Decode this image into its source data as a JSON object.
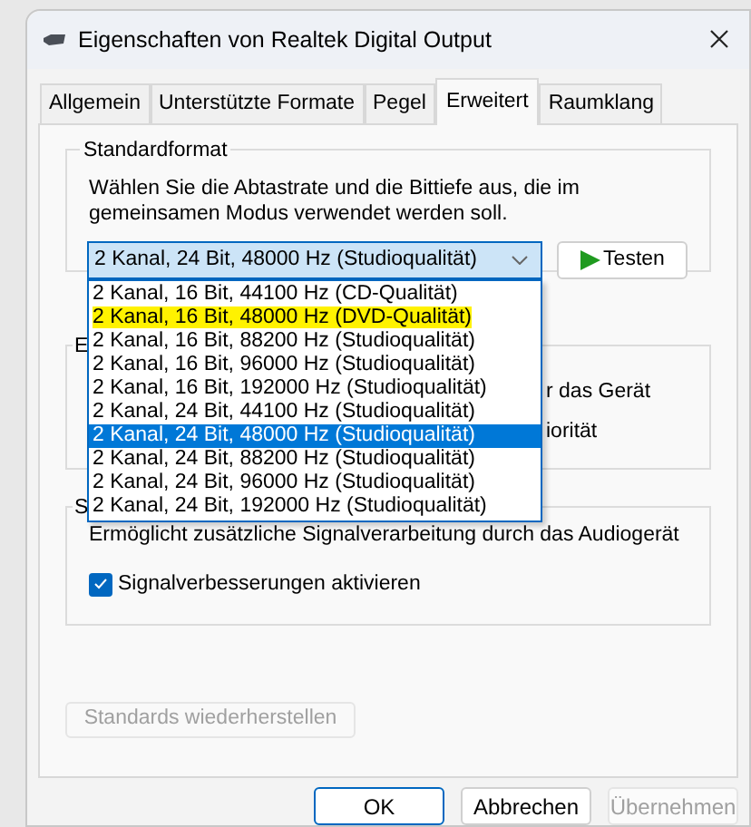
{
  "window": {
    "title": "Eigenschaften von Realtek Digital Output"
  },
  "tabs": [
    {
      "label": "Allgemein",
      "selected": false
    },
    {
      "label": "Unterstützte Formate",
      "selected": false
    },
    {
      "label": "Pegel",
      "selected": false
    },
    {
      "label": "Erweitert",
      "selected": true
    },
    {
      "label": "Raumklang",
      "selected": false
    }
  ],
  "default_format": {
    "group_label": "Standardformat",
    "description": "Wählen Sie die Abtastrate und die Bittiefe aus, die im gemeinsamen Modus verwendet werden soll.",
    "dropdown": {
      "value": "2 Kanal, 24 Bit, 48000 Hz (Studioqualität)",
      "expanded": true,
      "options": [
        {
          "label": "2 Kanal, 16 Bit, 44100 Hz (CD-Qualität)",
          "selected": false,
          "highlighted": false
        },
        {
          "label": "2 Kanal, 16 Bit, 48000 Hz (DVD-Qualität)",
          "selected": false,
          "highlighted": true
        },
        {
          "label": "2 Kanal, 16 Bit, 88200 Hz (Studioqualität)",
          "selected": false,
          "highlighted": false
        },
        {
          "label": "2 Kanal, 16 Bit, 96000 Hz (Studioqualität)",
          "selected": false,
          "highlighted": false
        },
        {
          "label": "2 Kanal, 16 Bit, 192000 Hz (Studioqualität)",
          "selected": false,
          "highlighted": false
        },
        {
          "label": "2 Kanal, 24 Bit, 44100 Hz (Studioqualität)",
          "selected": false,
          "highlighted": false
        },
        {
          "label": "2 Kanal, 24 Bit, 48000 Hz (Studioqualität)",
          "selected": true,
          "highlighted": false
        },
        {
          "label": "2 Kanal, 24 Bit, 88200 Hz (Studioqualität)",
          "selected": false,
          "highlighted": false
        },
        {
          "label": "2 Kanal, 24 Bit, 96000 Hz (Studioqualität)",
          "selected": false,
          "highlighted": false
        },
        {
          "label": "2 Kanal, 24 Bit, 192000 Hz (Studioqualität)",
          "selected": false,
          "highlighted": false
        }
      ]
    },
    "test_button": "Testen"
  },
  "exclusive_mode": {
    "group_label": "E",
    "lines": [
      "r das Gerät",
      "iorität"
    ]
  },
  "signal_enhancements": {
    "group_label": "S",
    "description": "Ermöglicht zusätzliche Signalverarbeitung durch das Audiogerät",
    "checkbox": {
      "label": "Signalverbesserungen aktivieren",
      "checked": true
    }
  },
  "restore_button": {
    "label": "Standards wiederherstellen",
    "disabled": true
  },
  "buttons": [
    {
      "label": "OK",
      "default": true,
      "disabled": false
    },
    {
      "label": "Abbrechen",
      "default": false,
      "disabled": false
    },
    {
      "label": "Übernehmen",
      "default": false,
      "disabled": true
    }
  ]
}
